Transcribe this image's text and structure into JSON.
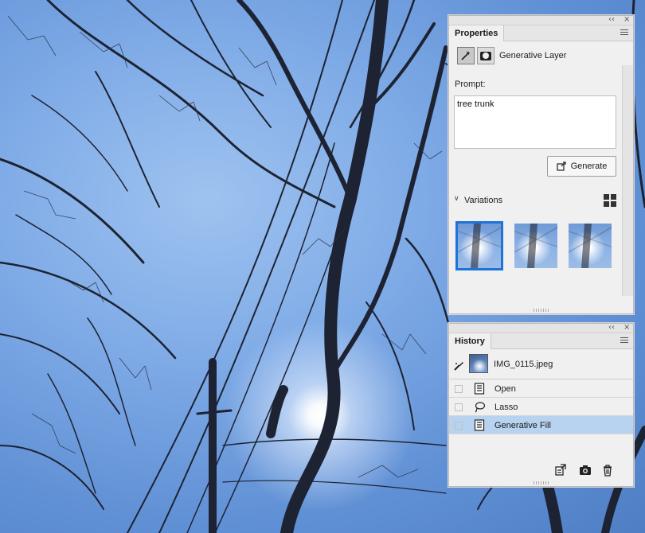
{
  "properties_panel": {
    "tab_label": "Properties",
    "layer_name": "Generative Layer",
    "prompt_label": "Prompt:",
    "prompt_value": "tree trunk",
    "generate_label": "Generate",
    "variations_label": "Variations",
    "selected_variation_index": 0,
    "variation_count": 3
  },
  "history_panel": {
    "tab_label": "History",
    "snapshot_name": "IMG_0115.jpeg",
    "items": [
      {
        "label": "Open",
        "icon": "document-icon"
      },
      {
        "label": "Lasso",
        "icon": "lasso-icon"
      },
      {
        "label": "Generative Fill",
        "icon": "document-icon"
      }
    ],
    "selected_index": 2
  },
  "panel_controls": {
    "collapse_glyph": "‹‹",
    "close_glyph": "×"
  },
  "colors": {
    "selection_blue": "#1e73d6",
    "history_selected_row": "#b7d3ef",
    "panel_background": "#f0f0f0"
  }
}
